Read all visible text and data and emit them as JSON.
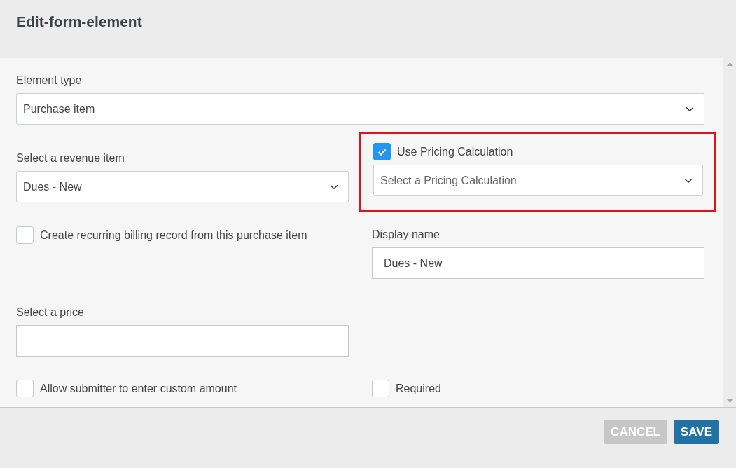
{
  "title": "Edit-form-element",
  "element_type": {
    "label": "Element type",
    "value": "Purchase item"
  },
  "revenue_item": {
    "label": "Select a revenue item",
    "value": "Dues - New"
  },
  "pricing": {
    "label": "Use Pricing Calculation",
    "checked": true,
    "placeholder": "Select a Pricing Calculation",
    "highlighted": true
  },
  "recurring": {
    "label": "Create recurring billing record from this purchase item",
    "checked": false
  },
  "display_name": {
    "label": "Display name",
    "value": "Dues - New"
  },
  "price": {
    "label": "Select a price"
  },
  "custom_amount": {
    "label": "Allow submitter to enter custom amount",
    "checked": false
  },
  "required": {
    "label": "Required",
    "checked": false
  },
  "buttons": [
    {
      "label": "CANCEL",
      "kind": "cancel"
    },
    {
      "label": "SAVE",
      "kind": "save"
    }
  ]
}
